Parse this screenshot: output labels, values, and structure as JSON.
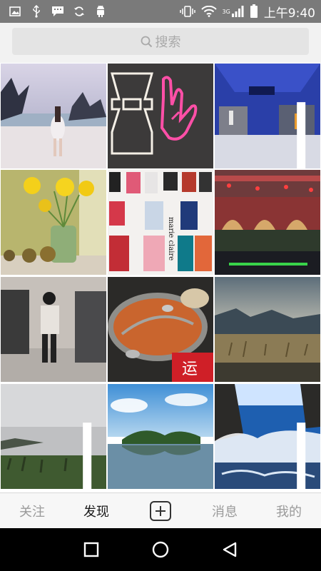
{
  "status_bar": {
    "time": "上午9:40",
    "network": "3G",
    "icons": [
      "gallery-icon",
      "usb-icon",
      "message-icon",
      "sync-icon",
      "android-icon",
      "vibrate-icon",
      "wifi-icon",
      "signal-icon",
      "battery-icon"
    ]
  },
  "search": {
    "placeholder": "搜索"
  },
  "grid": {
    "photos": [
      {
        "subject": "beach-woman",
        "multi": false
      },
      {
        "subject": "neon-signs",
        "multi": false
      },
      {
        "subject": "clothing-store",
        "multi": true
      },
      {
        "subject": "daffodils",
        "multi": false
      },
      {
        "subject": "magazine-spread",
        "multi": false
      },
      {
        "subject": "night-building",
        "multi": false
      },
      {
        "subject": "man-in-store",
        "multi": false
      },
      {
        "subject": "hotpot",
        "multi": false
      },
      {
        "subject": "sunset-mountains",
        "multi": false
      },
      {
        "subject": "misty-coast",
        "multi": true
      },
      {
        "subject": "lake-island",
        "multi": false
      },
      {
        "subject": "sea-waves",
        "multi": true
      }
    ],
    "magazine_text": "marie claire",
    "hotpot_sign": "运"
  },
  "tabs": {
    "follow": "关注",
    "discover": "发现",
    "add": "+",
    "messages": "消息",
    "me": "我的",
    "active": "discover"
  },
  "colors": {
    "status_bar": "#7a7a7a",
    "search_bg": "#e4e4e4",
    "tab_active": "#1a1a1a",
    "tab_inactive": "#9a9a9a"
  }
}
